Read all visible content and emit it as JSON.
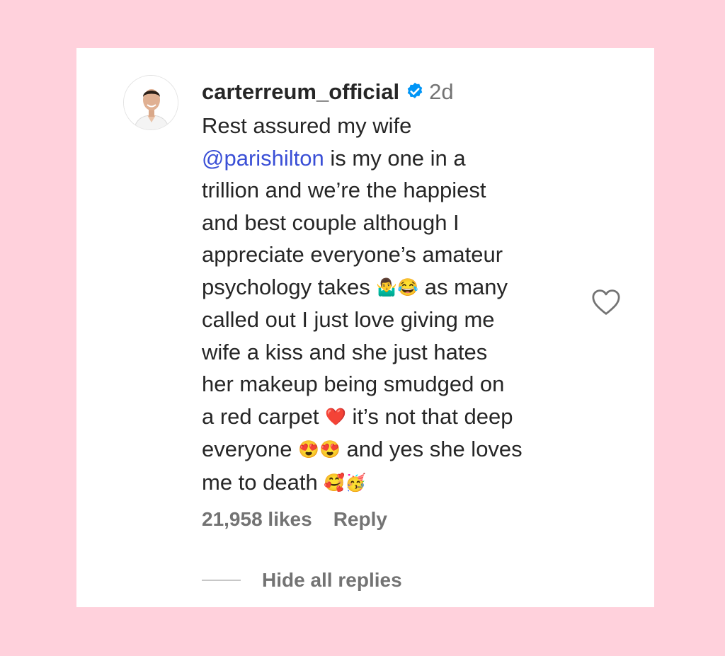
{
  "comment": {
    "username": "carterreum_official",
    "verified_icon": "verified-badge-icon",
    "timestamp": "2d",
    "line1": "Rest assured my wife",
    "mention": "@parishilton",
    "line2_rest": " is my one in a",
    "line3": "trillion and we’re the happiest",
    "line4": "and best couple although I",
    "line5": "appreciate everyone’s amateur",
    "line6_a": "psychology takes ",
    "emoji_shrug": "🤷‍♂️😂",
    "line6_b": " as many",
    "line7": "called out I just love giving me",
    "line8": "wife a kiss and she just hates",
    "line9": "her makeup being smudged on",
    "line10_a": "a red carpet ",
    "emoji_heart": "❤️",
    "line10_b": " it’s not that deep",
    "line11_a": "everyone ",
    "emoji_hearteyes": "😍😍",
    "line11_b": " and yes she loves",
    "line12_a": "me to death ",
    "emoji_party": "🥰🥳"
  },
  "actions": {
    "likes": "21,958 likes",
    "reply": "Reply"
  },
  "replies": {
    "toggle_label": "Hide all replies"
  },
  "icons": {
    "like": "heart-outline-icon",
    "avatar": "profile-avatar"
  },
  "colors": {
    "background": "#ffd1dc",
    "mention": "#3a4fd6",
    "verified": "#0095f6",
    "muted": "#737373"
  }
}
